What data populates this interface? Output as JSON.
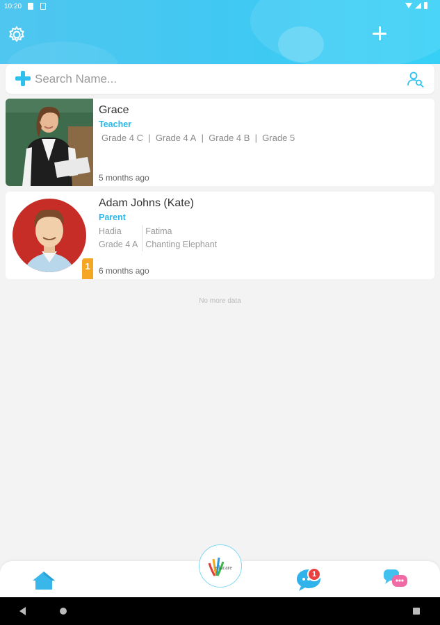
{
  "status_bar": {
    "time": "10:20"
  },
  "header": {
    "settings_icon": "gear-icon",
    "add_icon": "plus-icon",
    "colors": {
      "gradient_start": "#4fc6ef",
      "gradient_end": "#36d0f6"
    }
  },
  "search": {
    "placeholder": "Search Name...",
    "value": "",
    "add_icon": "plus-icon",
    "search_user_icon": "user-search-icon"
  },
  "contacts": [
    {
      "name": "Grace",
      "role": "Teacher",
      "grades": [
        "Grade 4 C",
        "Grade 4 A",
        "Grade 4 B",
        "Grade 5"
      ],
      "time": "5 months ago"
    },
    {
      "name": "Adam Johns (Kate)",
      "role": "Parent",
      "children": [
        {
          "name": "Hadia",
          "class": "Grade 4 A"
        },
        {
          "name": "Fatima",
          "class": "Chanting Elephant"
        }
      ],
      "badge": "1",
      "time": "6 months ago"
    }
  ],
  "no_more": "No more data",
  "bottom_nav": {
    "home_icon": "home-icon",
    "logo_text": "educare",
    "chat_icon": "chat-icon",
    "chat_badge": "1",
    "messages_icon": "messages-icon"
  },
  "accent_color": "#27b8ec"
}
